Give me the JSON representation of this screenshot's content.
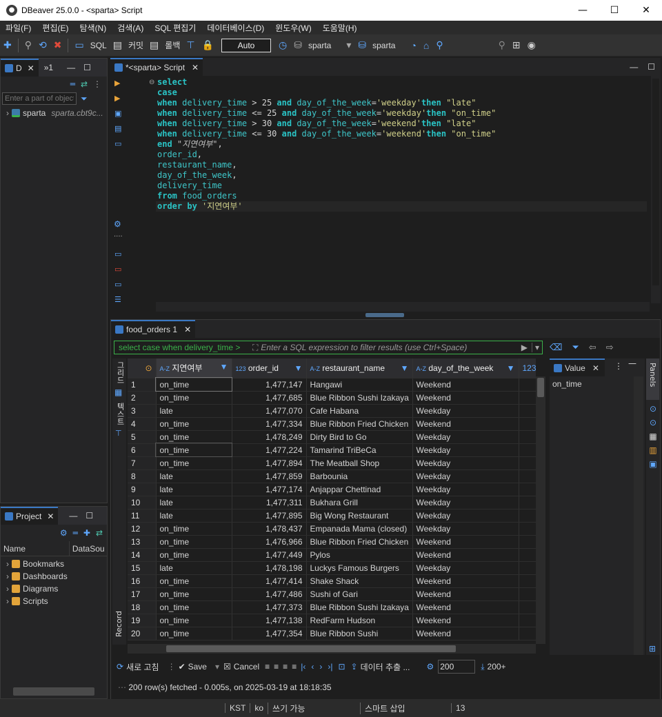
{
  "window": {
    "title": "DBeaver 25.0.0 - <sparta> Script"
  },
  "menu": [
    "파일(F)",
    "편집(E)",
    "탐색(N)",
    "검색(A)",
    "SQL 편집기",
    "데이터베이스(D)",
    "윈도우(W)",
    "도움말(H)"
  ],
  "toolbar": {
    "sql": "SQL",
    "commit": "커밋",
    "rollback": "롤백",
    "auto": "Auto",
    "db1": "sparta",
    "db2": "sparta"
  },
  "navigator": {
    "tab": "D",
    "tab2": "»1",
    "filter_placeholder": "Enter a part of object",
    "db_name": "sparta",
    "db_host": "sparta.cbt9c..."
  },
  "projects": {
    "tab": "Project",
    "col_name": "Name",
    "col_ds": "DataSou",
    "items": [
      "Bookmarks",
      "Dashboards",
      "Diagrams",
      "Scripts"
    ]
  },
  "editor": {
    "tab": "*<sparta> Script",
    "lines": [
      [
        [
          "kw",
          "select"
        ]
      ],
      [
        [
          "kw",
          "case"
        ]
      ],
      [
        [
          "kw",
          "when "
        ],
        [
          "id",
          "delivery_time"
        ],
        [
          "op",
          " > 25 "
        ],
        [
          "kw",
          "and "
        ],
        [
          "id",
          "day_of_the_week"
        ],
        [
          "op",
          "="
        ],
        [
          "str",
          "'weekday'"
        ],
        [
          "kw",
          "then "
        ],
        [
          "str",
          "\"late\""
        ]
      ],
      [
        [
          "kw",
          "when "
        ],
        [
          "id",
          "delivery_time"
        ],
        [
          "op",
          " <= 25 "
        ],
        [
          "kw",
          "and "
        ],
        [
          "id",
          "day_of_the_week"
        ],
        [
          "op",
          "="
        ],
        [
          "str",
          "'weekday'"
        ],
        [
          "kw",
          "then "
        ],
        [
          "str",
          "\"on_time\""
        ]
      ],
      [
        [
          "kw",
          "when "
        ],
        [
          "id",
          "delivery_time"
        ],
        [
          "op",
          " > 30 "
        ],
        [
          "kw",
          "and "
        ],
        [
          "id",
          "day_of_the_week"
        ],
        [
          "op",
          "="
        ],
        [
          "str",
          "'weekend'"
        ],
        [
          "kw",
          "then "
        ],
        [
          "str",
          "\"late\""
        ]
      ],
      [
        [
          "kw",
          "when "
        ],
        [
          "id",
          "delivery_time"
        ],
        [
          "op",
          " <= 30 "
        ],
        [
          "kw",
          "and "
        ],
        [
          "id",
          "day_of_the_week"
        ],
        [
          "op",
          "="
        ],
        [
          "str",
          "'weekend'"
        ],
        [
          "kw",
          "then "
        ],
        [
          "str",
          "\"on_time\""
        ]
      ],
      [
        [
          "kw",
          "end "
        ],
        [
          "cmt",
          "\"지연여부\""
        ],
        [
          "op",
          ","
        ]
      ],
      [
        [
          "id",
          "order_id"
        ],
        [
          "op",
          ","
        ]
      ],
      [
        [
          "id",
          "restaurant_name"
        ],
        [
          "op",
          ","
        ]
      ],
      [
        [
          "id",
          "day_of_the_week"
        ],
        [
          "op",
          ","
        ]
      ],
      [
        [
          "id",
          "delivery_time"
        ]
      ],
      [
        [
          "kw",
          "from "
        ],
        [
          "id",
          "food_orders"
        ]
      ],
      [
        [
          "kw",
          "order by "
        ],
        [
          "str",
          "'지연여부'"
        ]
      ]
    ]
  },
  "results": {
    "tab": "food_orders 1",
    "filter_left": "select case when delivery_time >",
    "filter_placeholder": "Enter a SQL expression to filter results (use Ctrl+Space)",
    "side_labels": {
      "grid": "그리드",
      "text": "텍스트",
      "record": "Record"
    },
    "columns": [
      "지연여부",
      "order_id",
      "restaurant_name",
      "day_of_the_week",
      "123"
    ],
    "column_types": [
      "A-Z",
      "123",
      "A-Z",
      "A-Z",
      ""
    ],
    "rows": [
      [
        "1",
        "on_time",
        "1,477,147",
        "Hangawi",
        "Weekend"
      ],
      [
        "2",
        "on_time",
        "1,477,685",
        "Blue Ribbon Sushi Izakaya",
        "Weekend"
      ],
      [
        "3",
        "late",
        "1,477,070",
        "Cafe Habana",
        "Weekday"
      ],
      [
        "4",
        "on_time",
        "1,477,334",
        "Blue Ribbon Fried Chicken",
        "Weekend"
      ],
      [
        "5",
        "on_time",
        "1,478,249",
        "Dirty Bird to Go",
        "Weekday"
      ],
      [
        "6",
        "on_time",
        "1,477,224",
        "Tamarind TriBeCa",
        "Weekday"
      ],
      [
        "7",
        "on_time",
        "1,477,894",
        "The Meatball Shop",
        "Weekday"
      ],
      [
        "8",
        "late",
        "1,477,859",
        "Barbounia",
        "Weekday"
      ],
      [
        "9",
        "late",
        "1,477,174",
        "Anjappar Chettinad",
        "Weekday"
      ],
      [
        "10",
        "late",
        "1,477,311",
        "Bukhara Grill",
        "Weekday"
      ],
      [
        "11",
        "late",
        "1,477,895",
        "Big Wong Restaurant",
        "Weekday"
      ],
      [
        "12",
        "on_time",
        "1,478,437",
        "Empanada Mama (closed)",
        "Weekday"
      ],
      [
        "13",
        "on_time",
        "1,476,966",
        "Blue Ribbon Fried Chicken",
        "Weekend"
      ],
      [
        "14",
        "on_time",
        "1,477,449",
        "Pylos",
        "Weekend"
      ],
      [
        "15",
        "late",
        "1,478,198",
        "Luckys Famous Burgers",
        "Weekday"
      ],
      [
        "16",
        "on_time",
        "1,477,414",
        "Shake Shack",
        "Weekend"
      ],
      [
        "17",
        "on_time",
        "1,477,486",
        "Sushi of Gari",
        "Weekend"
      ],
      [
        "18",
        "on_time",
        "1,477,373",
        "Blue Ribbon Sushi Izakaya",
        "Weekend"
      ],
      [
        "19",
        "on_time",
        "1,477,138",
        "RedFarm Hudson",
        "Weekend"
      ],
      [
        "20",
        "on_time",
        "1,477,354",
        "Blue Ribbon Sushi",
        "Weekend"
      ]
    ],
    "value_panel": {
      "tab": "Value",
      "value": "on_time",
      "panels_label": "Panels"
    },
    "bottom": {
      "refresh": "새로 고침",
      "save": "Save",
      "cancel": "Cancel",
      "export": "데이터 추출 ...",
      "limit": "200",
      "count": "200+"
    },
    "status": "200 row(s) fetched - 0.005s, on 2025-03-19 at 18:18:35"
  },
  "statusbar": {
    "tz": "KST",
    "lang": "ko",
    "mode": "쓰기 가능",
    "insert": "스마트 삽입",
    "pos": "13"
  }
}
